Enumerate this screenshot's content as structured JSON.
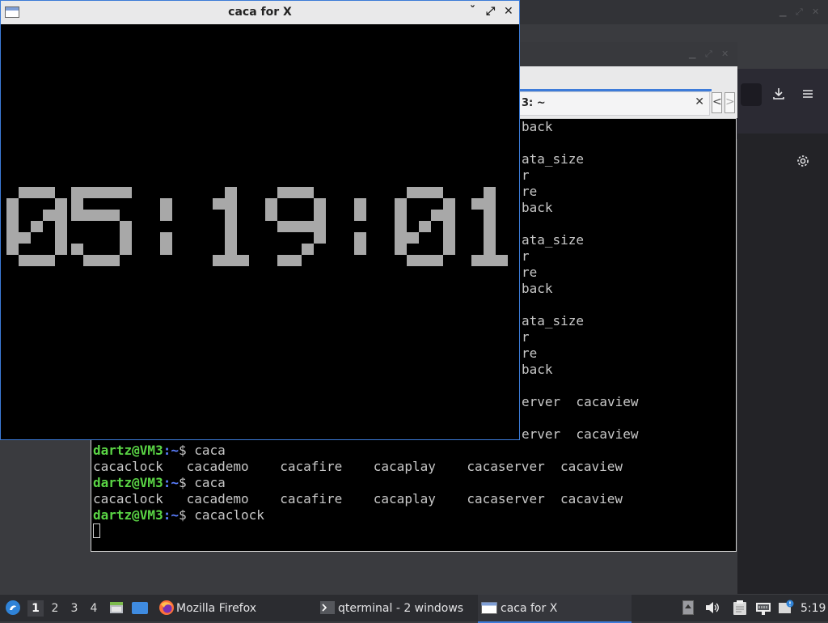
{
  "caca_window": {
    "title": "caca for X",
    "minimize_label": "ˇ",
    "maximize_label": "⤢",
    "close_label": "✕",
    "clock_text": "05:19:01",
    "clock_color": "#a8a8a8"
  },
  "qterminal": {
    "tab_title": "3: ~",
    "tab_close": "✕",
    "scroll_left": "<",
    "scroll_right": ">",
    "behind_lines": [
      "back",
      "",
      "ata_size",
      "r",
      "re",
      "back",
      "",
      "ata_size",
      "r",
      "re",
      "back",
      "",
      "ata_size",
      "r",
      "re",
      "back",
      "",
      "erver  cacaview",
      "",
      "erver  cacaview"
    ],
    "lines": [
      {
        "prompt": "dartz@VM3",
        "path": ":~",
        "cmd": "$ caca"
      },
      {
        "text": "cacaclock   cacademo    cacafire    cacaplay    cacaserver  cacaview"
      },
      {
        "prompt": "dartz@VM3",
        "path": ":~",
        "cmd": "$ caca"
      },
      {
        "text": "cacaclock   cacademo    cacafire    cacaplay    cacaserver  cacaview"
      },
      {
        "prompt": "dartz@VM3",
        "path": ":~",
        "cmd": "$ cacaclock"
      }
    ]
  },
  "firefox": {
    "download_icon": "download-icon",
    "menu_icon": "hamburger-menu-icon",
    "settings_icon": "gear-icon"
  },
  "taskbar": {
    "workspaces": [
      "1",
      "2",
      "3",
      "4"
    ],
    "active_workspace": "1",
    "tasks": [
      {
        "label": "Mozilla Firefox",
        "icon": "firefox-icon"
      },
      {
        "label": "qterminal - 2 windows",
        "icon": "terminal-icon"
      },
      {
        "label": "caca for X",
        "icon": "window-icon"
      }
    ],
    "clock": "5:19"
  },
  "colors": {
    "accent": "#3d7bd9",
    "prompt_green": "#5ad545",
    "path_blue": "#5b7fff"
  }
}
